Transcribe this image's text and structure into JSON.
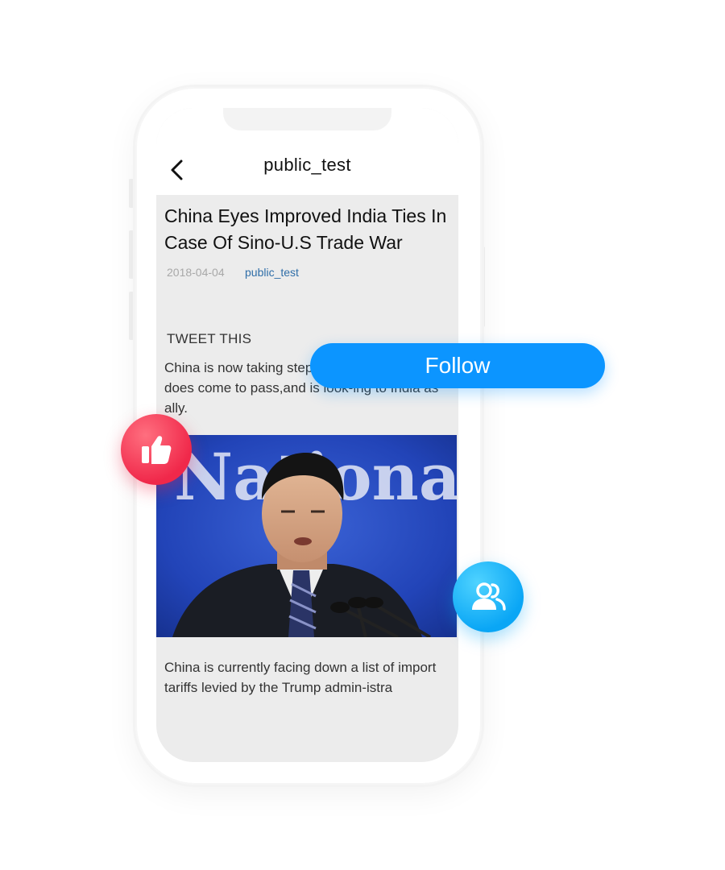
{
  "header": {
    "title": "public_test",
    "back_icon": "chevron-left-icon"
  },
  "article": {
    "headline": "China Eyes Improved India Ties In Case Of Sino-U.S Trade War",
    "date": "2018-04-04",
    "author": "public_test",
    "tweet_label": "TWEET THIS",
    "paragraph_1": "China is now taking steps in case a trade war does come to pass,and is look-ing to India as ally.",
    "photo_banner_text": "National",
    "paragraph_2": "China is currently facing down a list of import tariffs levied by the Trump admin-istra"
  },
  "floating": {
    "follow_label": "Follow",
    "like_icon": "thumbs-up-icon",
    "users_icon": "users-icon"
  },
  "colors": {
    "accent_blue": "#0c95ff",
    "like_red": "#f0284a",
    "users_cyan": "#0aa6f5",
    "link_blue": "#2f6ea8"
  }
}
